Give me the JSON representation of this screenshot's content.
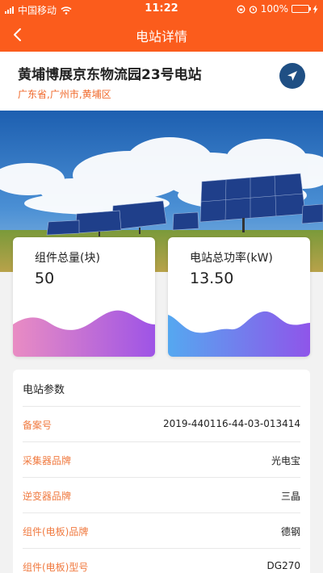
{
  "status_bar": {
    "carrier": "中国移动",
    "time": "11:22",
    "battery": "100%"
  },
  "nav": {
    "title": "电站详情"
  },
  "station": {
    "name": "黄埔博展京东物流园23号电站",
    "address": "广东省,广州市,黄埔区"
  },
  "stats": [
    {
      "label": "组件总量(块)",
      "value": "50"
    },
    {
      "label": "电站总功率(kW)",
      "value": "13.50"
    }
  ],
  "params": {
    "title": "电站参数",
    "rows": [
      {
        "key": "备案号",
        "value": "2019-440116-44-03-013414"
      },
      {
        "key": "采集器品牌",
        "value": "光电宝"
      },
      {
        "key": "逆变器品牌",
        "value": "三晶"
      },
      {
        "key": "组件(电板)品牌",
        "value": "德钢"
      },
      {
        "key": "组件(电板)型号",
        "value": "DG270"
      }
    ]
  },
  "colors": {
    "brand": "#fb5c1c",
    "nav_button": "#1f4f84",
    "param_key": "#f07a40"
  }
}
